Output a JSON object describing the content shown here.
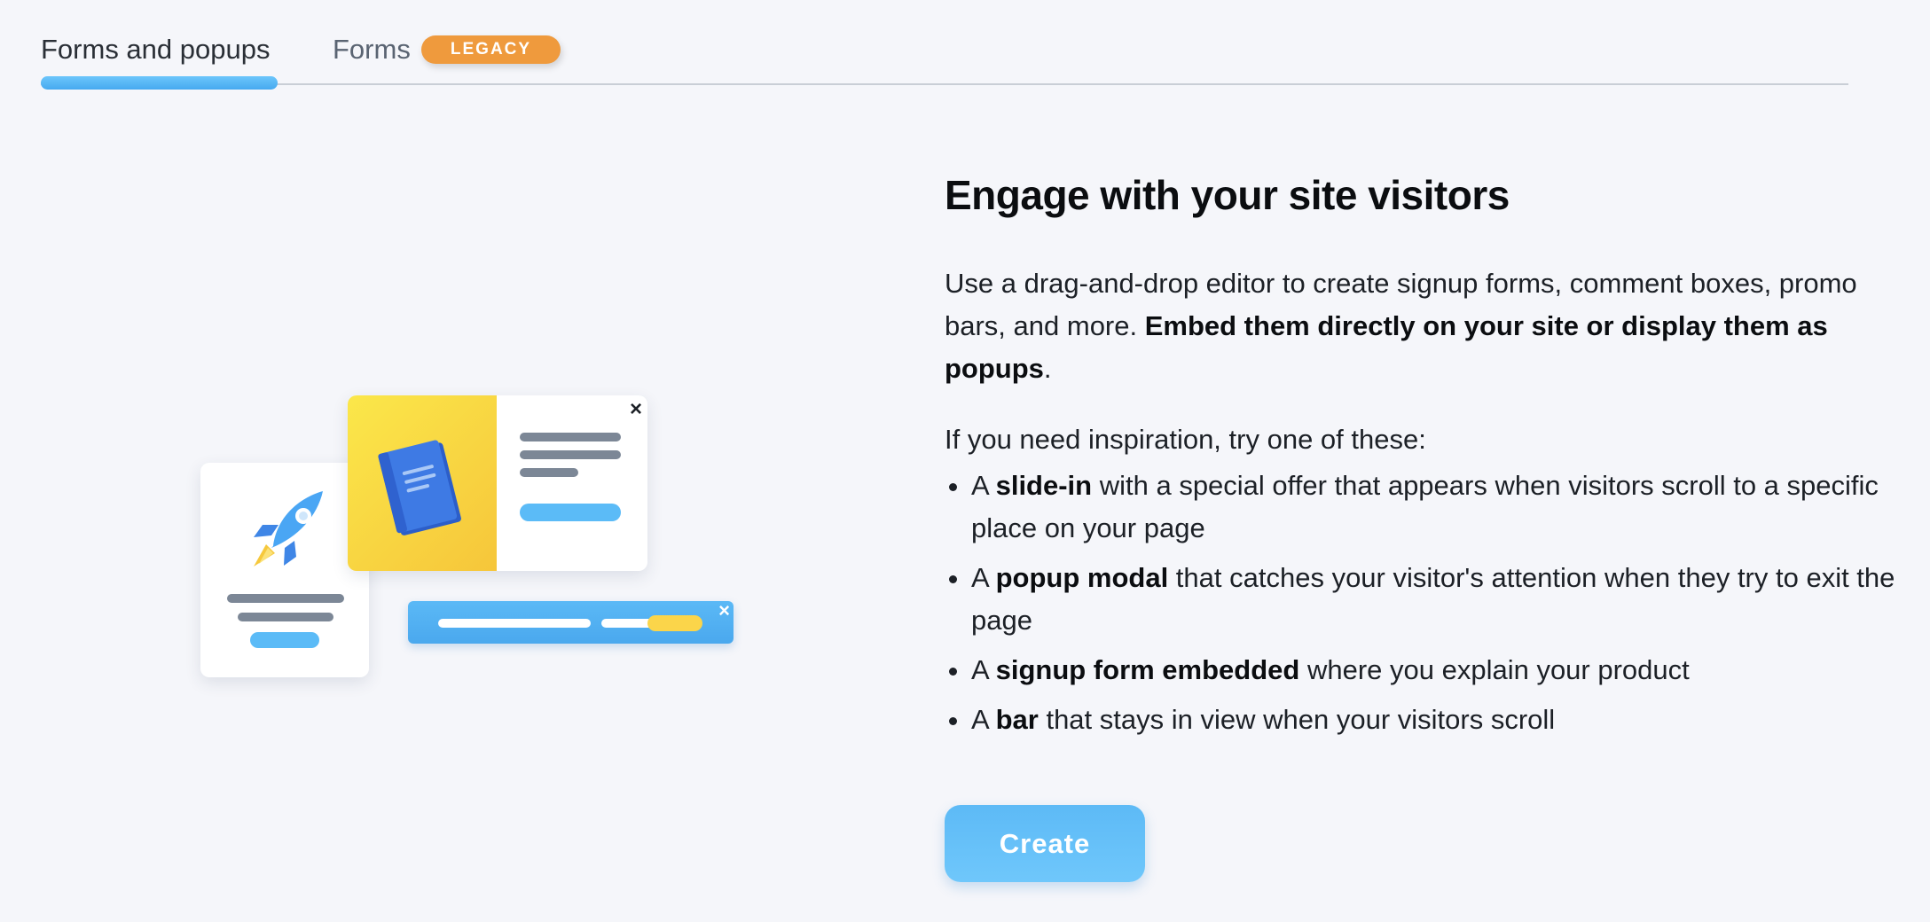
{
  "tabs": [
    {
      "label": "Forms and popups",
      "active": true
    },
    {
      "label": "Forms",
      "badge": "LEGACY",
      "active": false
    }
  ],
  "hero": {
    "heading": "Engage with your site visitors",
    "intro_text": "Use a drag-and-drop editor to create signup forms, comment boxes, promo bars, and more. ",
    "intro_bold": "Embed them directly on your site or display them as popups",
    "intro_end": ".",
    "inspiration": "If you need inspiration, try one of these:",
    "ideas": [
      {
        "pre": "A ",
        "bold": "slide-in",
        "post": " with a special offer that appears when visitors scroll to a specific place on your page"
      },
      {
        "pre": "A ",
        "bold": "popup modal",
        "post": " that catches your visitor's attention when they try to exit the page"
      },
      {
        "pre": "A ",
        "bold": "signup form embedded",
        "post": " where you explain your product"
      },
      {
        "pre": "A ",
        "bold": "bar",
        "post": " that stays in view when your visitors scroll"
      }
    ],
    "create_label": "Create"
  },
  "illustration": {
    "close_glyph": "×",
    "icons": [
      "rocket-icon",
      "book-icon",
      "close-icon"
    ]
  },
  "colors": {
    "accent": "#5bbbf7",
    "badge": "#ef9a3d",
    "background": "#f5f6fa"
  }
}
